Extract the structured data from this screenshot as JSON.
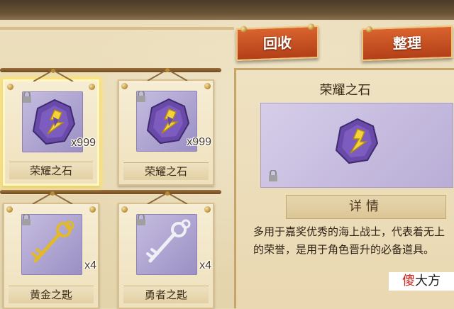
{
  "top_buttons": {
    "recycle": "回收",
    "sort": "整理"
  },
  "inventory": [
    {
      "name": "荣耀之石",
      "qty": "x999",
      "icon": "glory-stone-icon",
      "selected": true
    },
    {
      "name": "荣耀之石",
      "qty": "x999",
      "icon": "glory-stone-icon",
      "selected": false
    },
    {
      "name": "黄金之匙",
      "qty": "x4",
      "icon": "golden-key-icon",
      "selected": false
    },
    {
      "name": "勇者之匙",
      "qty": "x4",
      "icon": "silver-key-icon",
      "selected": false
    }
  ],
  "detail": {
    "title": "荣耀之石",
    "section_label": "详情",
    "description": "多用于嘉奖优秀的海上战士，代表着无上的荣誉，是用于角色晋升的必备道具。"
  },
  "watermark": {
    "part1": "傻",
    "part2": "大方"
  },
  "colors": {
    "accent_button": "#c24a1f",
    "stone": "#6a4aa8",
    "gold": "#e8c53a"
  }
}
